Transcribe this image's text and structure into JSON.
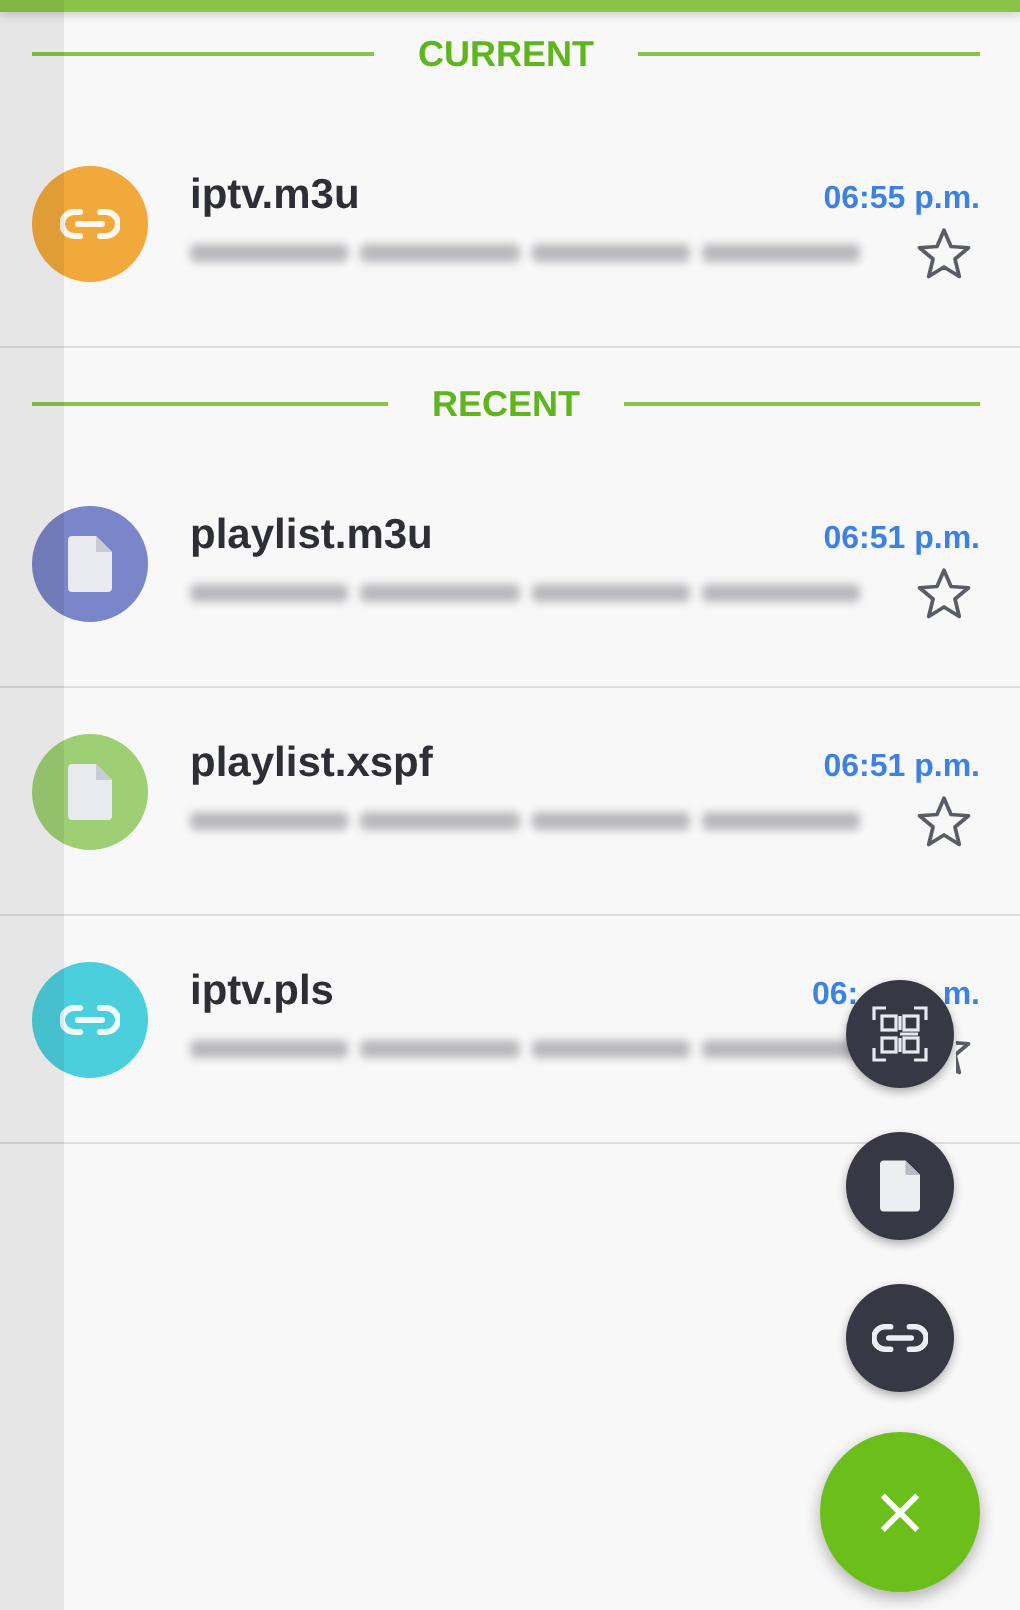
{
  "sections": [
    {
      "title": "CURRENT",
      "items": [
        {
          "name": "iptv.m3u",
          "time": "06:55 p.m.",
          "kind": "link",
          "color": "#f2a93b",
          "starred": false
        }
      ]
    },
    {
      "title": "RECENT",
      "items": [
        {
          "name": "playlist.m3u",
          "time": "06:51 p.m.",
          "kind": "file",
          "color": "#7b85c9",
          "starred": false
        },
        {
          "name": "playlist.xspf",
          "time": "06:51 p.m.",
          "kind": "file",
          "color": "#9fcf74",
          "starred": false
        },
        {
          "name": "iptv.pls",
          "time_parts": [
            "06:",
            "m."
          ],
          "kind": "link",
          "color": "#4ccfdc",
          "starred": false,
          "star_clipped": true
        }
      ]
    }
  ],
  "fab_actions": [
    {
      "kind": "qr"
    },
    {
      "kind": "file"
    },
    {
      "kind": "link"
    }
  ],
  "fab_main": {
    "label": "×"
  }
}
